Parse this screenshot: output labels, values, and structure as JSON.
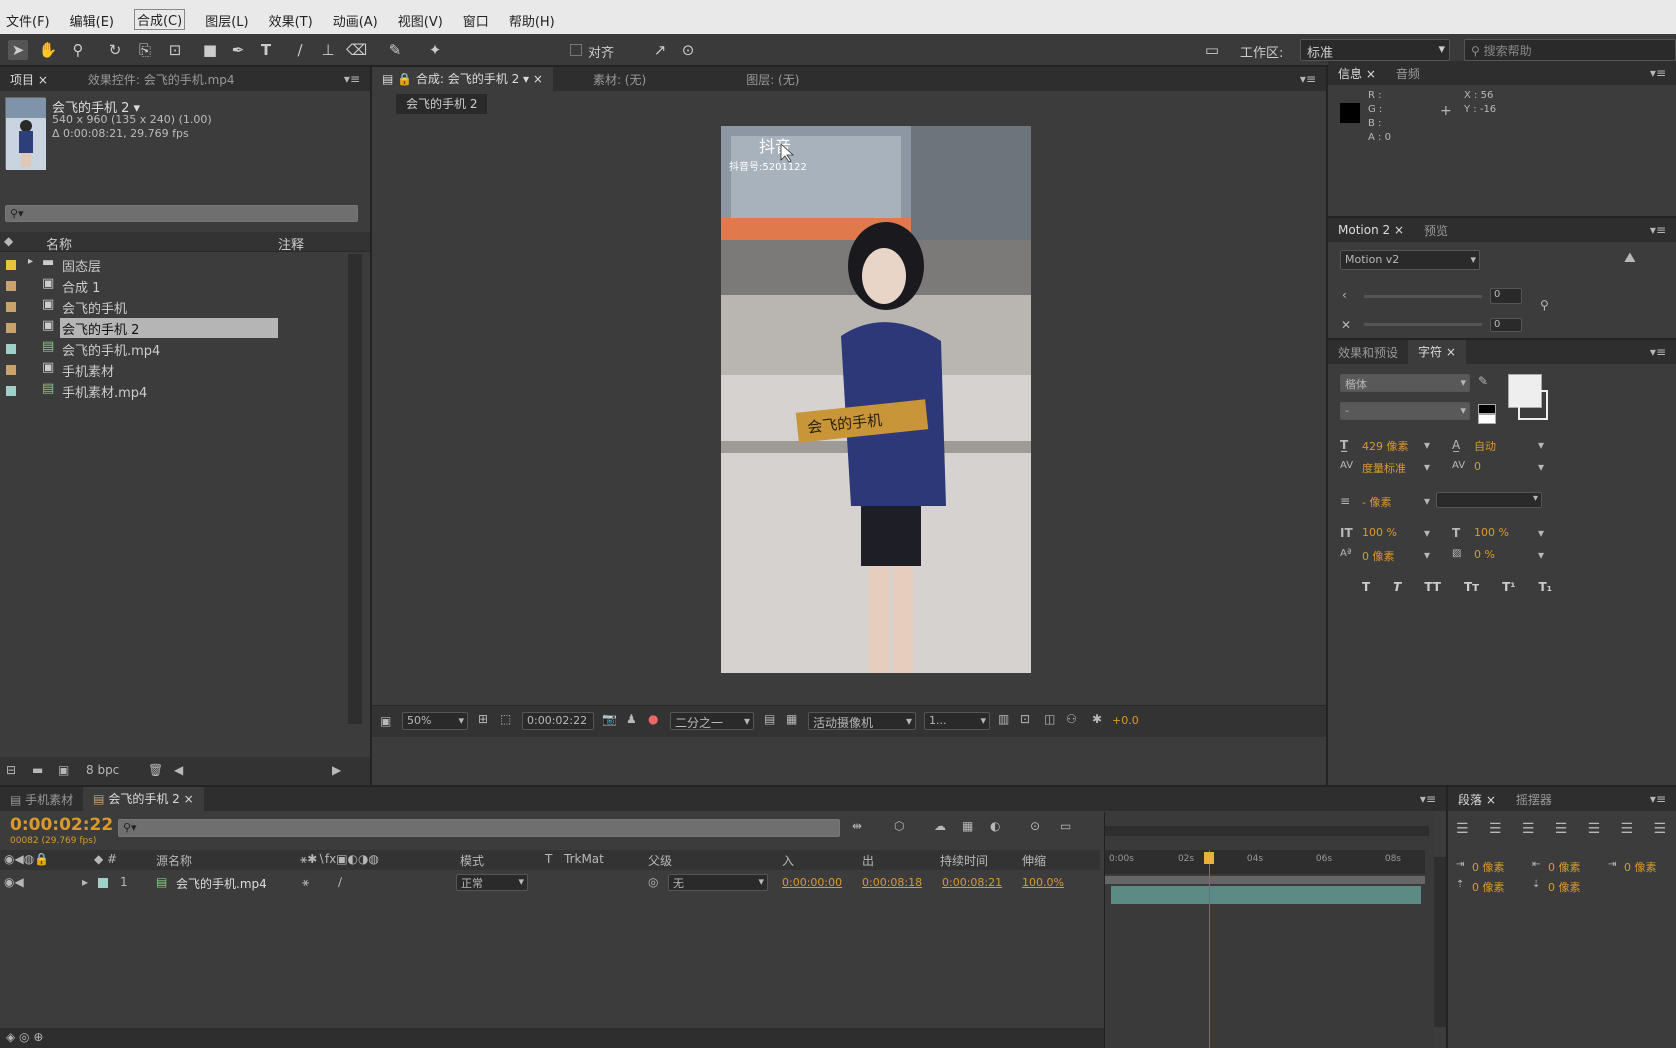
{
  "menu": [
    "文件(F)",
    "编辑(E)",
    "合成(C)",
    "图层(L)",
    "效果(T)",
    "动画(A)",
    "视图(V)",
    "窗口",
    "帮助(H)"
  ],
  "toolbar": {
    "align_label": "对齐",
    "workspace_label": "工作区:",
    "workspace_value": "标准",
    "search_placeholder": "搜索帮助"
  },
  "project": {
    "tabs": [
      "项目",
      "效果控件: 会飞的手机.mp4"
    ],
    "preview_name": "会飞的手机 2 ▾",
    "preview_dims": "540 x 960  (135 x 240) (1.00)",
    "preview_time": "Δ 0:00:08:21, 29.769 fps",
    "col_name": "名称",
    "col_comment": "注释",
    "items": [
      {
        "label": "固态层",
        "color": "#e8c33a",
        "type": "folder"
      },
      {
        "label": "合成 1",
        "color": "#c9a36b",
        "type": "comp"
      },
      {
        "label": "会飞的手机",
        "color": "#c9a36b",
        "type": "comp"
      },
      {
        "label": "会飞的手机 2",
        "color": "#c9a36b",
        "type": "comp",
        "selected": true
      },
      {
        "label": "会飞的手机.mp4",
        "color": "#9fd1c9",
        "type": "footage"
      },
      {
        "label": "手机素材",
        "color": "#c9a36b",
        "type": "comp"
      },
      {
        "label": "手机素材.mp4",
        "color": "#9fd1c9",
        "type": "footage"
      }
    ],
    "bpc": "8 bpc"
  },
  "composition": {
    "tabs": [
      "合成: 会飞的手机 2",
      "素材: (无)",
      "图层: (无)"
    ],
    "sub_tab": "会飞的手机 2",
    "footer": {
      "zoom": "50%",
      "timecode": "0:00:02:22",
      "resolution": "二分之一",
      "camera": "活动摄像机",
      "views": "1...",
      "exposure": "+0.0"
    },
    "video_overlay": {
      "app": "抖音",
      "id": "抖音号:5201122",
      "sign_text": "会飞的手机"
    }
  },
  "info": {
    "tabs": [
      "信息",
      "音频"
    ],
    "r": "R :",
    "g": "G :",
    "b": "B :",
    "a": "A : 0",
    "x": "X : 56",
    "y": "Y : -16"
  },
  "motion": {
    "tabs": [
      "Motion 2",
      "预览"
    ],
    "dropdown": "Motion v2",
    "value1": "0",
    "value2": "0"
  },
  "character": {
    "tabs": [
      "效果和预设",
      "字符"
    ],
    "font": "楷体",
    "style": "-",
    "size": "429 像素",
    "leading": "自动",
    "kerning": "度量标准",
    "tracking": "0",
    "stroke": "- 像素",
    "vscale": "100 %",
    "hscale": "100 %",
    "baseline": "0 像素",
    "tsume": "0 %",
    "style_buttons": [
      "T",
      "T",
      "TT",
      "Tт",
      "T¹",
      "T₁"
    ]
  },
  "timeline": {
    "tabs": [
      "手机素材",
      "会飞的手机 2"
    ],
    "timecode": "0:00:02:22",
    "frames": "00082 (29.769 fps)",
    "columns": [
      "源名称",
      "模式",
      "T",
      "TrkMat",
      "父级",
      "入",
      "出",
      "持续时间",
      "伸缩"
    ],
    "layer": {
      "index": "1",
      "name": "会飞的手机.mp4",
      "mode": "正常",
      "parent": "无",
      "in": "0:00:00:00",
      "out": "0:00:08:18",
      "duration": "0:00:08:21",
      "stretch": "100.0%"
    },
    "ruler": [
      "0:00s",
      "02s",
      "04s",
      "06s",
      "08s"
    ],
    "playhead_seconds": 2.73,
    "duration_seconds": 8.7
  },
  "paragraph": {
    "tabs": [
      "段落",
      "摇摆器"
    ],
    "indent1": "0 像素",
    "indent2": "0 像素",
    "indent3": "0 像素",
    "space1": "0 像素",
    "space2": "0 像素"
  }
}
